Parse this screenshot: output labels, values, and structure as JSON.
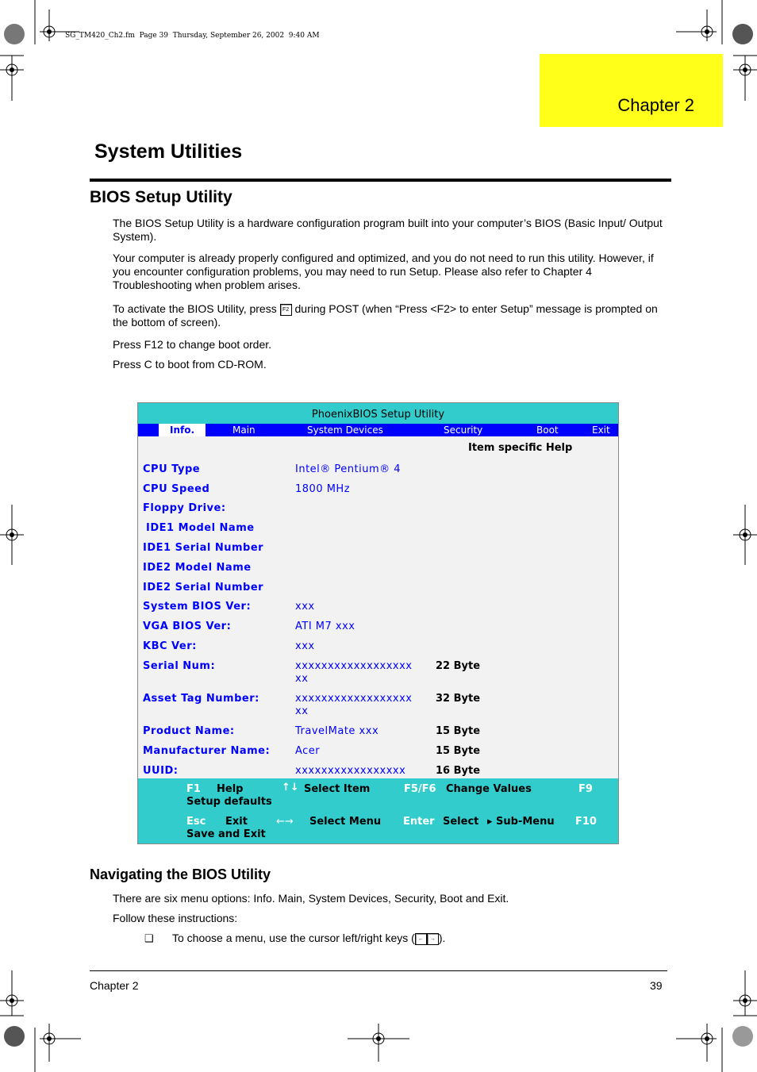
{
  "print_header": "SG_TM420_Ch2.fm  Page 39  Thursday, September 26, 2002  9:40 AM",
  "chapter_tab": "Chapter  2",
  "title": "System Utilities",
  "section": {
    "heading": "BIOS Setup Utility",
    "p1": "The BIOS Setup Utility is a hardware configuration program built into your computer’s BIOS (Basic Input/ Output System).",
    "p2": "Your computer is already properly configured and optimized, and you do not need to run this utility. However, if you encounter configuration problems, you may need to run Setup.  Please also refer to Chapter 4 Troubleshooting when problem arises.",
    "p3_a": "To activate the BIOS Utility, press",
    "p3_key": "F2",
    "p3_b": "during POST (when “Press <F2> to enter Setup” message is prompted on the bottom of screen).",
    "p4": "Press F12 to change boot order.",
    "p5": "Press C to boot from CD-ROM."
  },
  "bios": {
    "title": "PhoenixBIOS Setup Utility",
    "menu": [
      "Info.",
      "Main",
      "System Devices",
      "Security",
      "Boot",
      "Exit"
    ],
    "help_header": "Item specific Help",
    "rows": [
      {
        "label": "CPU Type",
        "value": "Intel® Pentium® 4",
        "size": ""
      },
      {
        "label": "CPU Speed",
        "value": "1800 MHz",
        "size": ""
      },
      {
        "label": "Floppy Drive:",
        "value": "",
        "size": ""
      },
      {
        "label": "IDE1 Model Name",
        "value": "",
        "size": ""
      },
      {
        "label": "IDE1 Serial Number",
        "value": "",
        "size": ""
      },
      {
        "label": "IDE2 Model Name",
        "value": "",
        "size": ""
      },
      {
        "label": "IDE2 Serial Number",
        "value": "",
        "size": ""
      },
      {
        "label": "System BIOS Ver:",
        "value": "xxx",
        "size": ""
      },
      {
        "label": "VGA BIOS Ver:",
        "value": "ATI M7 xxx",
        "size": ""
      },
      {
        "label": "KBC Ver:",
        "value": "xxx",
        "size": ""
      },
      {
        "label": "Serial Num:",
        "value": "xxxxxxxxxxxxxxxxxx",
        "value2": "xx",
        "size": "22 Byte"
      },
      {
        "label": "Asset Tag Number:",
        "value": "xxxxxxxxxxxxxxxxxx",
        "value2": "xx",
        "size": "32 Byte"
      },
      {
        "label": "Product Name:",
        "value": "TravelMate xxx",
        "size": "15 Byte"
      },
      {
        "label": "Manufacturer Name:",
        "value": "Acer",
        "size": "15 Byte"
      },
      {
        "label": "UUID:",
        "value": "xxxxxxxxxxxxxxxxx",
        "size": "16 Byte"
      }
    ],
    "footer": {
      "f1": "F1",
      "f1_label": "Help",
      "updown": "↑↓",
      "updown_label": "Select Item",
      "f5f6": "F5/F6",
      "f5f6_label": "Change Values",
      "f9": "F9",
      "f9_label": "Setup defaults",
      "esc": "Esc",
      "esc_label": "Exit",
      "leftright": "←→",
      "leftright_label": "Select Menu",
      "enter": "Enter",
      "enter_label": "Select",
      "submenu": "▸ Sub-Menu",
      "f10": "F10",
      "f10_label": "Save and Exit"
    }
  },
  "nav": {
    "heading": "Navigating the BIOS Utility",
    "p1": "There are six menu options:  Info. Main, System Devices, Security, Boot and Exit.",
    "p2": "Follow these instructions:",
    "bullet": "❑",
    "item_a": "To choose a menu, use the cursor left/right keys (",
    "item_b": ")."
  },
  "footer": {
    "left": "Chapter 2",
    "right": "39"
  },
  "colors": {
    "chapter_tab": "#ffff1a",
    "bios_teal": "#33cccc",
    "bios_blue": "#0000ff",
    "bios_bg": "#f2f2f2"
  }
}
